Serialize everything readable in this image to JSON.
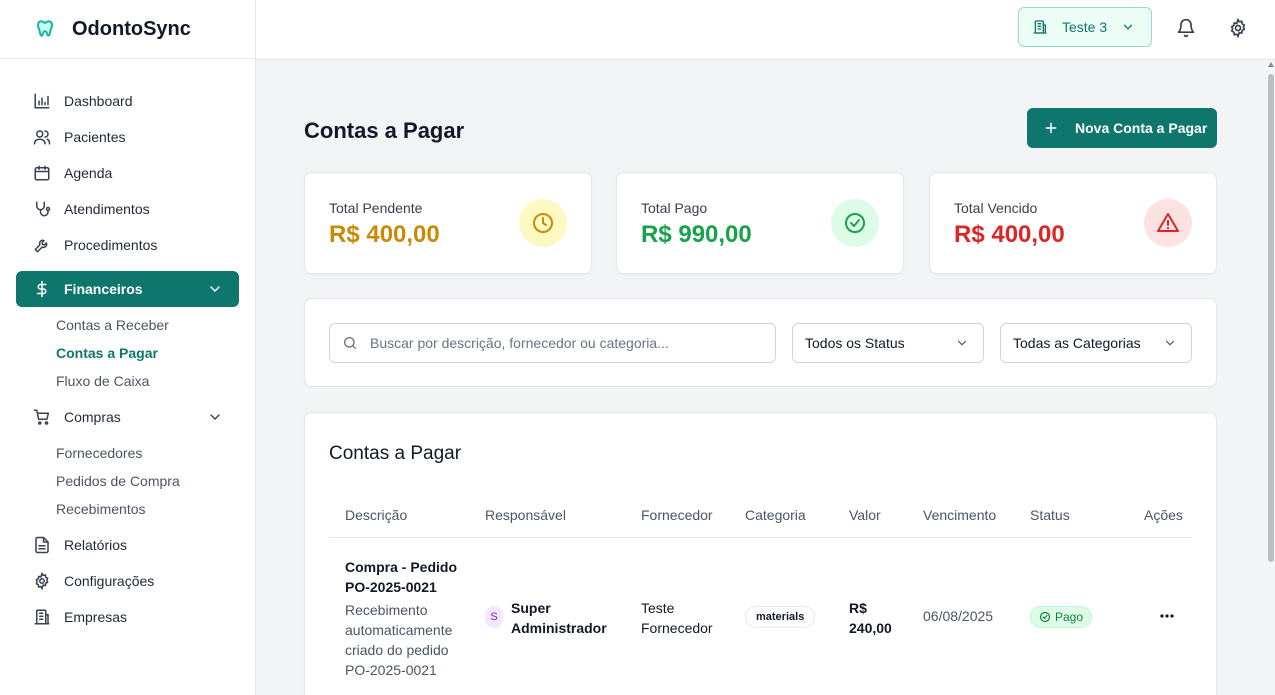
{
  "app": {
    "name": "OdontoSync"
  },
  "colors": {
    "accent": "#0f766e",
    "pending": "#ca8a04",
    "paid": "#16a34a",
    "overdue": "#dc2626"
  },
  "sidebar": {
    "items": [
      {
        "label": "Dashboard",
        "icon": "bar-chart-icon"
      },
      {
        "label": "Pacientes",
        "icon": "users-icon"
      },
      {
        "label": "Agenda",
        "icon": "calendar-icon"
      },
      {
        "label": "Atendimentos",
        "icon": "stethoscope-icon"
      },
      {
        "label": "Procedimentos",
        "icon": "wrench-icon"
      },
      {
        "label": "Financeiros",
        "icon": "dollar-icon"
      },
      {
        "label": "Compras",
        "icon": "cart-icon"
      },
      {
        "label": "Relatórios",
        "icon": "file-text-icon"
      },
      {
        "label": "Configurações",
        "icon": "gear-icon"
      },
      {
        "label": "Empresas",
        "icon": "building-icon"
      }
    ],
    "financeiros_sub": [
      "Contas a Receber",
      "Contas a Pagar",
      "Fluxo de Caixa"
    ],
    "compras_sub": [
      "Fornecedores",
      "Pedidos de Compra",
      "Recebimentos"
    ]
  },
  "header": {
    "company": "Teste 3"
  },
  "page": {
    "title": "Contas a Pagar",
    "new_button": "Nova Conta a Pagar"
  },
  "stats": [
    {
      "label": "Total Pendente",
      "value": "R$ 400,00",
      "icon": "clock-icon"
    },
    {
      "label": "Total Pago",
      "value": "R$ 990,00",
      "icon": "check-circle-icon"
    },
    {
      "label": "Total Vencido",
      "value": "R$ 400,00",
      "icon": "alert-triangle-icon"
    }
  ],
  "filters": {
    "search_placeholder": "Buscar por descrição, fornecedor ou categoria...",
    "status": "Todos os Status",
    "category": "Todas as Categorias"
  },
  "table": {
    "title": "Contas a Pagar",
    "columns": [
      "Descrição",
      "Responsável",
      "Fornecedor",
      "Categoria",
      "Valor",
      "Vencimento",
      "Status",
      "Ações"
    ],
    "rows": [
      {
        "descricao": "Compra - Pedido PO-2025-0021",
        "detalhe": "Recebimento automaticamente criado do pedido PO-2025-0021",
        "avatar": "S",
        "responsavel": "Super Administrador",
        "fornecedor": "Teste Fornecedor",
        "categoria": "materials",
        "valor": "R$ 240,00",
        "vencimento": "06/08/2025",
        "status": "Pago"
      }
    ]
  }
}
